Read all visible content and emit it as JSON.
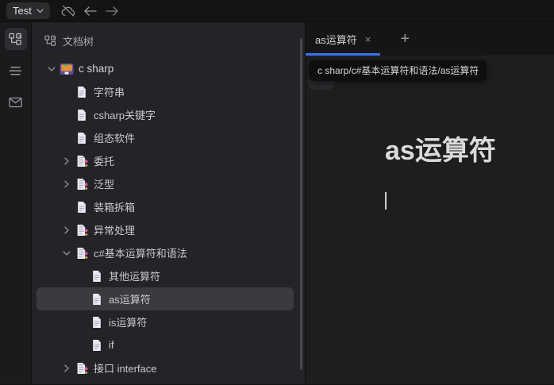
{
  "toolbar": {
    "workspace_label": "Test",
    "workspace_chevron_icon": "chevron-down-icon",
    "icons": [
      "cloud-off-icon",
      "arrow-left-icon",
      "arrow-right-icon"
    ]
  },
  "dock": {
    "items": [
      {
        "id": "file-tree",
        "icon": "file-tree-icon",
        "active": true
      },
      {
        "id": "outline",
        "icon": "outline-icon",
        "active": false
      },
      {
        "id": "inbox",
        "icon": "mail-icon",
        "active": false
      }
    ]
  },
  "tree": {
    "header": "文档树",
    "header_icon": "file-tree-icon",
    "items": [
      {
        "id": "c-sharp",
        "label": "c sharp",
        "kind": "notebook",
        "level": 0,
        "toggle": "expanded",
        "selected": false
      },
      {
        "id": "string",
        "label": "字符串",
        "kind": "doc",
        "level": 1,
        "toggle": "none",
        "selected": false
      },
      {
        "id": "csharp-keywords",
        "label": "csharp关键字",
        "kind": "doc",
        "level": 1,
        "toggle": "none",
        "selected": false
      },
      {
        "id": "scada",
        "label": "组态软件",
        "kind": "doc",
        "level": 1,
        "toggle": "none",
        "selected": false
      },
      {
        "id": "delegate",
        "label": "委托",
        "kind": "branch",
        "level": 1,
        "toggle": "collapsed",
        "selected": false
      },
      {
        "id": "generic",
        "label": "泛型",
        "kind": "branch",
        "level": 1,
        "toggle": "collapsed",
        "selected": false
      },
      {
        "id": "boxing",
        "label": "装箱拆箱",
        "kind": "doc",
        "level": 1,
        "toggle": "none",
        "selected": false
      },
      {
        "id": "exception",
        "label": "异常处理",
        "kind": "branch",
        "level": 1,
        "toggle": "collapsed",
        "selected": false
      },
      {
        "id": "operators-syntax",
        "label": "c#基本运算符和语法",
        "kind": "branch",
        "level": 1,
        "toggle": "expanded",
        "selected": false
      },
      {
        "id": "other-operators",
        "label": "其他运算符",
        "kind": "doc",
        "level": 2,
        "toggle": "none",
        "selected": false
      },
      {
        "id": "as-operator",
        "label": "as运算符",
        "kind": "doc",
        "level": 2,
        "toggle": "none",
        "selected": true
      },
      {
        "id": "is-operator",
        "label": "is运算符",
        "kind": "doc",
        "level": 2,
        "toggle": "none",
        "selected": false
      },
      {
        "id": "if",
        "label": "if",
        "kind": "doc",
        "level": 2,
        "toggle": "none",
        "selected": false
      },
      {
        "id": "interface",
        "label": "接口 interface",
        "kind": "branch",
        "level": 1,
        "toggle": "collapsed",
        "selected": false
      }
    ]
  },
  "tabs": [
    {
      "label": "as运算符",
      "close_label": "×",
      "active": true
    }
  ],
  "new_tab_label": "+",
  "editor": {
    "breadcrumb_tooltip": "c sharp/c#基本运算符和语法/as运算符",
    "title": "as运算符"
  },
  "colors": {
    "accent": "#3574f0",
    "window_bg": "#141414",
    "panel_bg": "#242428",
    "editor_bg": "#1e1e1f",
    "selected_row_bg": "#3a3a3f"
  }
}
